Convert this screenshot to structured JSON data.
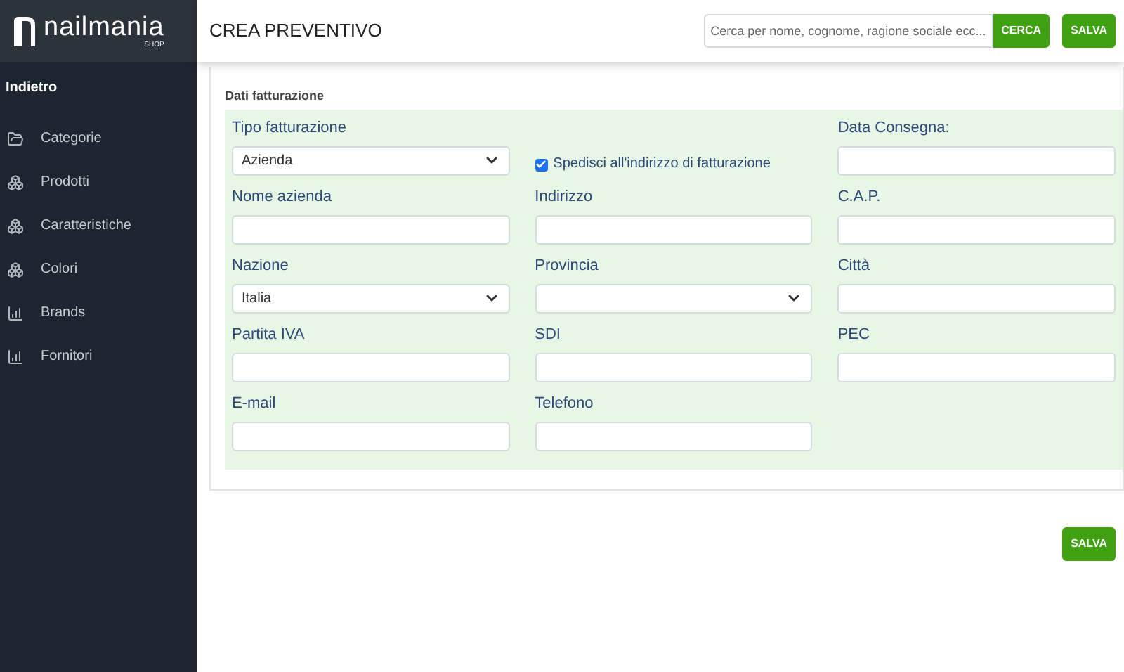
{
  "logo": {
    "name": "nailmania",
    "tagline": "SHOP"
  },
  "sidebar": {
    "back": "Indietro",
    "items": [
      {
        "label": "Categorie"
      },
      {
        "label": "Prodotti"
      },
      {
        "label": "Caratteristiche"
      },
      {
        "label": "Colori"
      },
      {
        "label": "Brands"
      },
      {
        "label": "Fornitori"
      }
    ]
  },
  "header": {
    "title": "CREA PREVENTIVO",
    "search": {
      "placeholder": "Cerca per nome, cognome, ragione sociale ecc..."
    },
    "search_button": "CERCA",
    "save_button": "SALVA"
  },
  "section": {
    "title": "Dati fatturazione",
    "fields": [
      {
        "kind": "select",
        "label": "Tipo fatturazione",
        "value": "Azienda"
      },
      {
        "kind": "checkbox",
        "label": "Spedisci all'indirizzo di fatturazione",
        "checked": true
      },
      {
        "kind": "text",
        "label": "Data Consegna:"
      },
      {
        "kind": "text",
        "label": "Nome azienda"
      },
      {
        "kind": "text",
        "label": "Indirizzo"
      },
      {
        "kind": "text",
        "label": "C.A.P."
      },
      {
        "kind": "select",
        "label": "Nazione",
        "value": "Italia"
      },
      {
        "kind": "select",
        "label": "Provincia"
      },
      {
        "kind": "text",
        "label": "Città"
      },
      {
        "kind": "text",
        "label": "Partita IVA"
      },
      {
        "kind": "text",
        "label": "SDI"
      },
      {
        "kind": "text",
        "label": "PEC"
      },
      {
        "kind": "text",
        "label": "E-mail"
      },
      {
        "kind": "text",
        "label": "Telefono"
      }
    ]
  },
  "footer": {
    "save_button": "SALVA"
  }
}
